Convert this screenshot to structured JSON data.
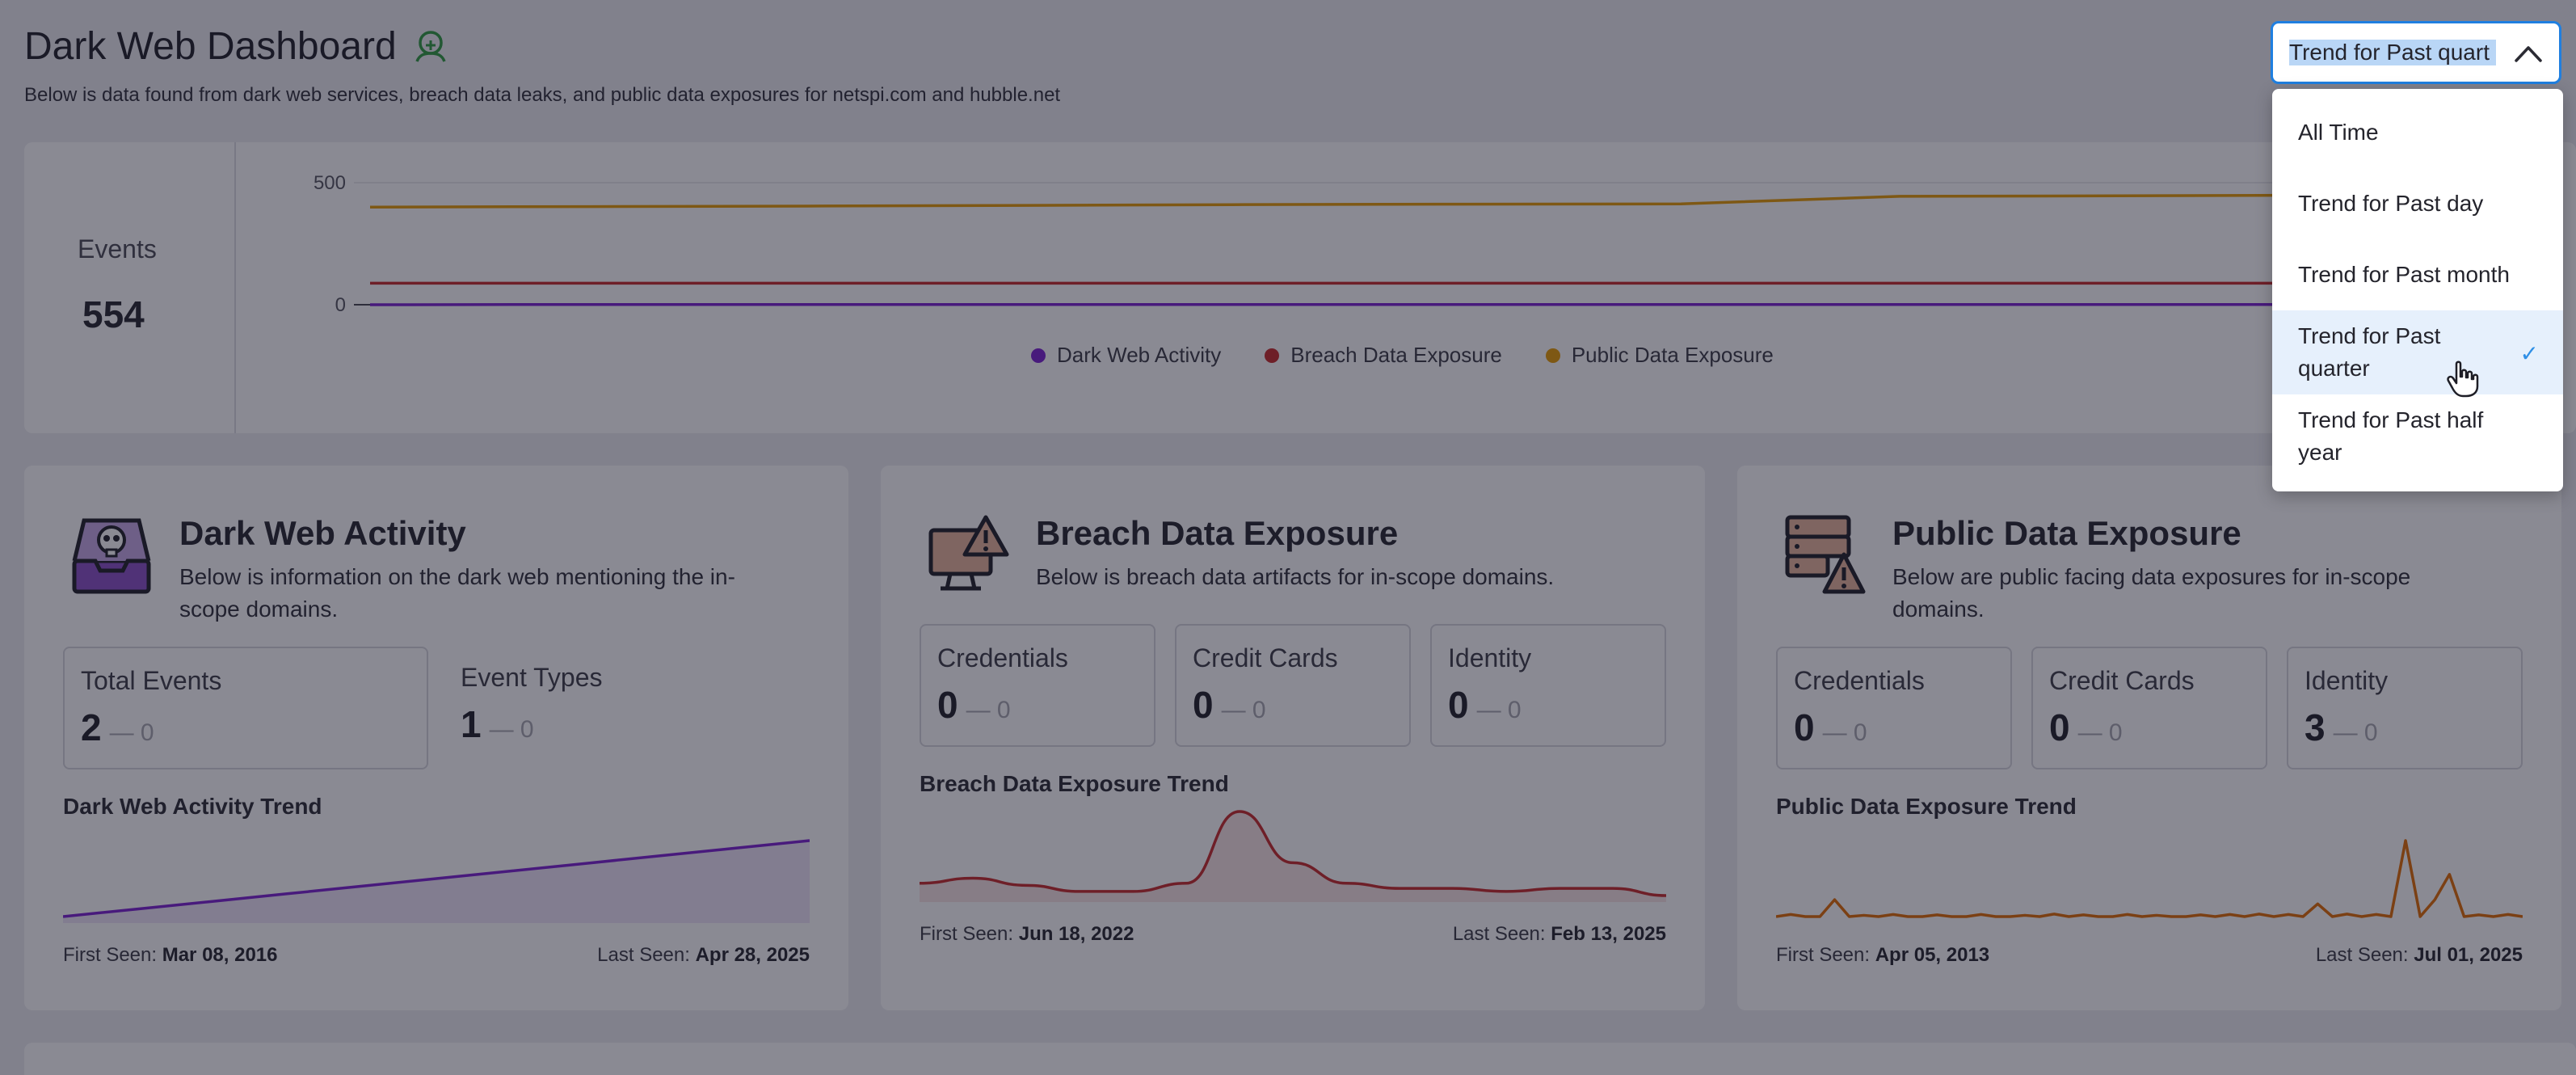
{
  "header": {
    "title": "Dark Web Dashboard",
    "subtitle": "Below is data found from dark web services, breach data leaks, and public data exposures for netspi.com and hubble.net",
    "title_icon": "spy-shield-icon"
  },
  "overview": {
    "events_label": "Events",
    "events_value": "554",
    "chart_data": {
      "type": "line",
      "title": "",
      "xlabel": "",
      "ylabel": "",
      "y_ticks": [
        "500",
        "0"
      ],
      "ylim": [
        -40,
        560
      ],
      "x": [
        0,
        1,
        2,
        3,
        4,
        5,
        6,
        7,
        8,
        9,
        10
      ],
      "series": [
        {
          "name": "Dark Web Activity",
          "color": "#7b1fd1",
          "values": [
            0,
            1,
            1,
            1,
            1,
            1,
            1,
            1,
            1,
            1,
            2
          ]
        },
        {
          "name": "Breach Data Exposure",
          "color": "#c62828",
          "values": [
            88,
            88,
            88,
            88,
            88,
            88,
            88,
            88,
            88,
            88,
            88
          ]
        },
        {
          "name": "Public Data Exposure",
          "color": "#e69a00",
          "values": [
            400,
            402,
            404,
            407,
            410,
            412,
            413,
            444,
            446,
            449,
            452
          ]
        }
      ],
      "legend_position": "bottom-center",
      "grid": true
    }
  },
  "cards": {
    "dark_web": {
      "title": "Dark Web Activity",
      "description": "Below is information on the dark web mentioning the in-scope domains.",
      "icon": "skull-inbox-icon",
      "stats": [
        {
          "label": "Total Events",
          "value": "2",
          "delta": "— 0"
        },
        {
          "label": "Event Types",
          "value": "1",
          "delta": "— 0"
        }
      ],
      "trend_title": "Dark Web Activity Trend",
      "trend_color": "#7b1fd1",
      "trend_values": [
        0,
        1,
        2,
        3,
        4,
        5,
        6,
        7,
        8,
        9,
        10
      ],
      "first_seen_label": "First Seen:",
      "first_seen": "Mar 08, 2016",
      "last_seen_label": "Last Seen:",
      "last_seen": "Apr 28, 2025"
    },
    "breach": {
      "title": "Breach Data Exposure",
      "description": "Below is breach data artifacts for in-scope domains.",
      "icon": "monitor-alert-icon",
      "stats": [
        {
          "label": "Credentials",
          "value": "0",
          "delta": "— 0"
        },
        {
          "label": "Credit Cards",
          "value": "0",
          "delta": "— 0"
        },
        {
          "label": "Identity",
          "value": "0",
          "delta": "— 0"
        }
      ],
      "trend_title": "Breach Data Exposure Trend",
      "trend_color": "#c62828",
      "trend_values": [
        2,
        2.5,
        1.8,
        1.2,
        1.2,
        2,
        9,
        4,
        2,
        1.5,
        1.5,
        1.2,
        1.5,
        1.5,
        0.8
      ],
      "first_seen_label": "First Seen:",
      "first_seen": "Jun 18, 2022",
      "last_seen_label": "Last Seen:",
      "last_seen": "Feb 13, 2025"
    },
    "public": {
      "title": "Public Data Exposure",
      "description": "Below are public facing data exposures for in-scope domains.",
      "icon": "server-alert-icon",
      "stats": [
        {
          "label": "Credentials",
          "value": "0",
          "delta": "— 0"
        },
        {
          "label": "Credit Cards",
          "value": "0",
          "delta": "— 0"
        },
        {
          "label": "Identity",
          "value": "3",
          "delta": "— 0"
        }
      ],
      "trend_title": "Public Data Exposure Trend",
      "trend_color": "#e06a00",
      "trend_values": [
        0,
        0.5,
        0,
        0,
        4,
        0,
        0.3,
        0,
        0.5,
        0,
        0,
        0.4,
        0,
        0,
        0.5,
        0,
        0,
        0.3,
        0,
        0.6,
        0,
        0.4,
        0,
        0,
        0.5,
        0,
        0.3,
        0,
        0,
        0.4,
        0,
        0.5,
        0,
        0.6,
        0,
        0.5,
        0,
        3,
        0,
        0.6,
        0,
        0.5,
        0,
        18,
        0,
        4,
        10,
        0,
        0.4,
        0,
        0.5,
        0
      ],
      "first_seen_label": "First Seen:",
      "first_seen": "Apr 05, 2013",
      "last_seen_label": "Last Seen:",
      "last_seen": "Jul 01, 2025"
    }
  },
  "range_select": {
    "value": "Trend for Past quarter",
    "visible_text": "Trend for Past quart",
    "options": [
      "All Time",
      "Trend for Past day",
      "Trend for Past month",
      "Trend for Past quarter",
      "Trend for Past half year"
    ],
    "selected_index": 3,
    "check_mark": "✓"
  }
}
